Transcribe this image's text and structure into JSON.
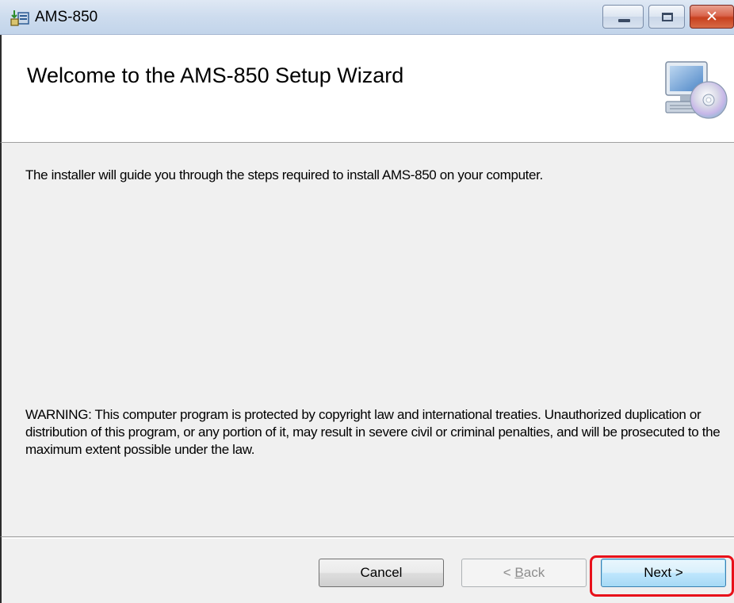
{
  "window": {
    "title": "AMS-850",
    "minimize_icon": "minimize-icon",
    "maximize_icon": "maximize-icon",
    "close_icon": "close-icon",
    "close_glyph": "✕"
  },
  "header": {
    "title": "Welcome to the AMS-850 Setup Wizard",
    "icon": "computer-cd-icon"
  },
  "content": {
    "intro": "The installer will guide you through the steps required to install AMS-850 on your computer.",
    "warning": "WARNING: This computer program is protected by copyright law and international treaties. Unauthorized duplication or distribution of this program, or any portion of it, may result in severe civil or criminal penalties, and will be prosecuted to the maximum extent possible under the law."
  },
  "buttons": {
    "cancel": "Cancel",
    "back_arrow": "< ",
    "back_mnemonic": "B",
    "back_rest": "ack",
    "back_enabled": false,
    "next": "Next >",
    "next_default": true
  },
  "annotation": {
    "highlight_color": "#e8101a",
    "highlight_target": "next-button"
  }
}
